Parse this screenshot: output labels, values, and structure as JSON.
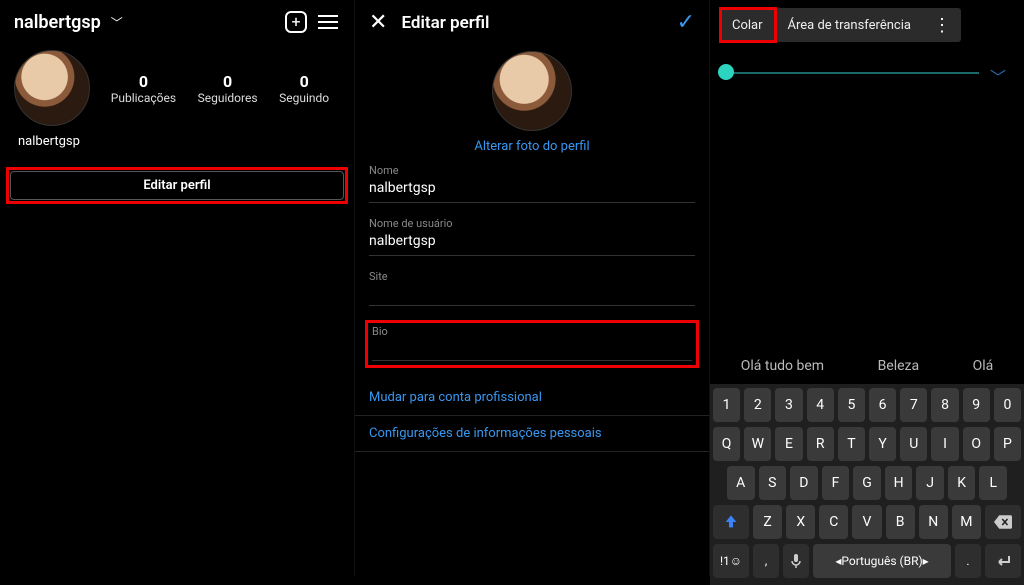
{
  "panel1": {
    "username": "nalbertgsp",
    "stats": {
      "posts": {
        "n": "0",
        "label": "Publicações"
      },
      "followers": {
        "n": "0",
        "label": "Seguidores"
      },
      "following": {
        "n": "0",
        "label": "Seguindo"
      }
    },
    "display_name": "nalbertgsp",
    "edit_button": "Editar perfil"
  },
  "panel2": {
    "title": "Editar perfil",
    "change_photo": "Alterar foto do perfil",
    "fields": {
      "name": {
        "label": "Nome",
        "value": "nalbertgsp"
      },
      "username": {
        "label": "Nome de usuário",
        "value": "nalbertgsp"
      },
      "site": {
        "label": "Site",
        "value": ""
      },
      "bio": {
        "label": "Bio",
        "value": ""
      }
    },
    "switch_pro": "Mudar para conta profissional",
    "personal_info": "Configurações de informações pessoais"
  },
  "panel3": {
    "context_menu": {
      "paste": "Colar",
      "clipboard": "Área de transferência"
    },
    "suggestions": [
      "Olá tudo bem",
      "Beleza",
      "Olá"
    ],
    "keyboard": {
      "row1": [
        "1",
        "2",
        "3",
        "4",
        "5",
        "6",
        "7",
        "8",
        "9",
        "0"
      ],
      "row2": [
        "Q",
        "W",
        "E",
        "R",
        "T",
        "Y",
        "U",
        "I",
        "O",
        "P"
      ],
      "row3": [
        "A",
        "S",
        "D",
        "F",
        "G",
        "H",
        "J",
        "K",
        "L"
      ],
      "row4": [
        "Z",
        "X",
        "C",
        "V",
        "B",
        "N",
        "M"
      ],
      "sym": "!1☺",
      "lang": "Português (BR)"
    }
  }
}
